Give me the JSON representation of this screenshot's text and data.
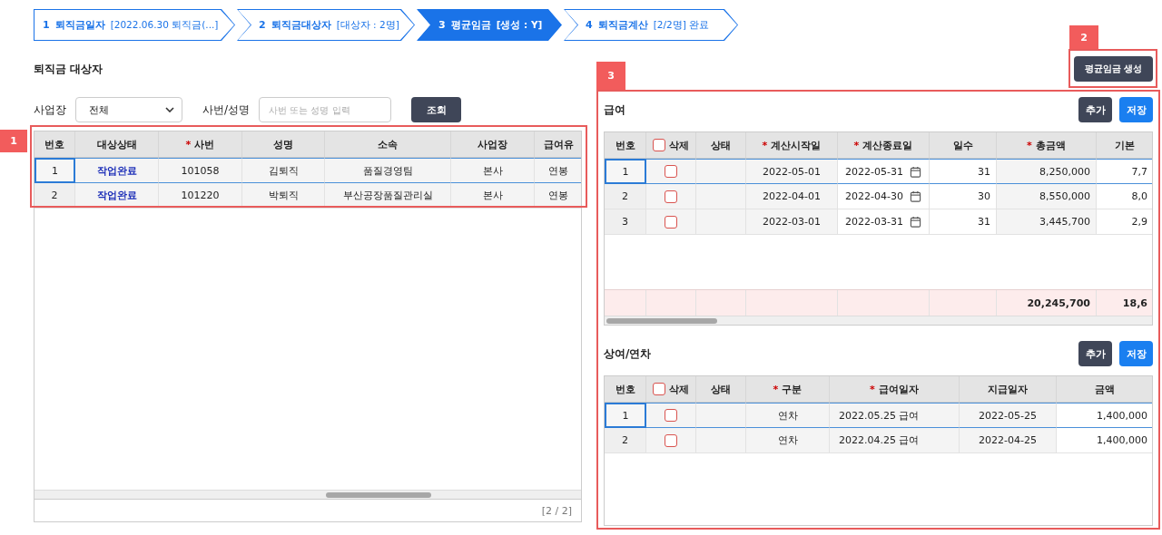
{
  "steps": [
    {
      "number": "1",
      "title": "퇴직금일자",
      "detail": "[2022.06.30 퇴직금(...]",
      "selected": false
    },
    {
      "number": "2",
      "title": "퇴직금대상자",
      "detail": "[대상자 : 2명]",
      "selected": false
    },
    {
      "number": "3",
      "title": "평균임금",
      "detail": "[생성 : Y]",
      "selected": true
    },
    {
      "number": "4",
      "title": "퇴직금계산",
      "detail": "[2/2명] 완료",
      "selected": false
    }
  ],
  "annotations": [
    {
      "label": "1"
    },
    {
      "label": "2"
    },
    {
      "label": "3"
    }
  ],
  "targets": {
    "title": "퇴직금 대상자",
    "filters": {
      "site_label": "사업장",
      "site_value": "전체",
      "search_label": "사번/성명",
      "search_placeholder": "사번 또는 성명 입력",
      "search_button": "조회"
    },
    "table": {
      "columns": [
        {
          "label": "번호",
          "kind": "index"
        },
        {
          "label": "대상상태",
          "kind": "link"
        },
        {
          "label": "사번",
          "kind": "text",
          "mark": "*"
        },
        {
          "label": "성명",
          "kind": "text"
        },
        {
          "label": "소속",
          "kind": "text"
        },
        {
          "label": "사업장",
          "kind": "text"
        },
        {
          "label": "급여유",
          "kind": "text"
        }
      ],
      "rows": [
        {
          "selected": true,
          "cells": [
            "1",
            "작업완료",
            "101058",
            "김퇴직",
            "품질경영팀",
            "본사",
            "연봉"
          ]
        },
        {
          "selected": false,
          "cells": [
            "2",
            "작업완료",
            "101220",
            "박퇴직",
            "부산공장품질관리실",
            "본사",
            "연봉"
          ]
        }
      ],
      "pager": "[2 / 2]"
    }
  },
  "generate_button": "평균임금 생성",
  "pay": {
    "title": "급여",
    "buttons": [
      {
        "label": "추가",
        "kind": "dark"
      },
      {
        "label": "저장",
        "kind": "primary"
      }
    ],
    "table": {
      "header_checked": false,
      "columns": [
        {
          "label": "번호",
          "kind": "index"
        },
        {
          "label": "삭제",
          "kind": "check"
        },
        {
          "label": "상태",
          "kind": "status"
        },
        {
          "label": "계산시작일",
          "kind": "center",
          "mark": "*"
        },
        {
          "label": "계산종료일",
          "kind": "date-input",
          "mark": "*"
        },
        {
          "label": "일수",
          "kind": "number-input"
        },
        {
          "label": "총금액",
          "kind": "money",
          "mark": "*"
        },
        {
          "label": "기본",
          "kind": "number-input"
        }
      ],
      "rows": [
        {
          "selected": true,
          "checked": false,
          "cells": [
            "1",
            "",
            "",
            "2022-05-01",
            "2022-05-31",
            "31",
            "8,250,000",
            "7,7"
          ]
        },
        {
          "selected": false,
          "checked": false,
          "cells": [
            "2",
            "",
            "",
            "2022-04-01",
            "2022-04-30",
            "30",
            "8,550,000",
            "8,0"
          ]
        },
        {
          "selected": false,
          "checked": false,
          "cells": [
            "3",
            "",
            "",
            "2022-03-01",
            "2022-03-31",
            "31",
            "3,445,700",
            "2,9"
          ]
        }
      ],
      "totals": [
        "20,245,700",
        "18,6"
      ]
    }
  },
  "bonus": {
    "title": "상여/연차",
    "buttons": [
      {
        "label": "추가",
        "kind": "dark"
      },
      {
        "label": "저장",
        "kind": "primary"
      }
    ],
    "table": {
      "header_checked": false,
      "columns": [
        {
          "label": "번호",
          "kind": "index"
        },
        {
          "label": "삭제",
          "kind": "check"
        },
        {
          "label": "상태",
          "kind": "status"
        },
        {
          "label": "구분",
          "kind": "center",
          "mark": "*"
        },
        {
          "label": "급여일자",
          "kind": "left",
          "mark": "*"
        },
        {
          "label": "지급일자",
          "kind": "center"
        },
        {
          "label": "금액",
          "kind": "number-input"
        }
      ],
      "rows": [
        {
          "selected": true,
          "checked": false,
          "cells": [
            "1",
            "",
            "",
            "연차",
            "2022.05.25 급여",
            "2022-05-25",
            "1,400,000"
          ]
        },
        {
          "selected": false,
          "checked": false,
          "cells": [
            "2",
            "",
            "",
            "연차",
            "2022.04.25 급여",
            "2022-04-25",
            "1,400,000"
          ]
        }
      ]
    }
  }
}
